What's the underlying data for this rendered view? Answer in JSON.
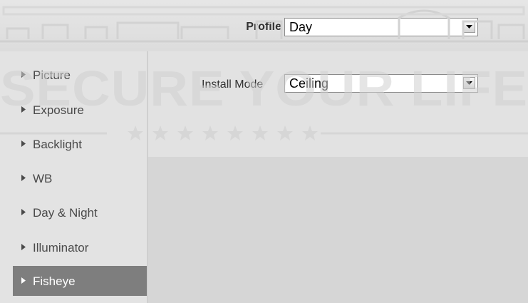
{
  "header": {
    "profile_label": "Profile",
    "profile_value": "Day"
  },
  "sidebar": {
    "items": [
      {
        "label": "Picture"
      },
      {
        "label": "Exposure"
      },
      {
        "label": "Backlight"
      },
      {
        "label": "WB"
      },
      {
        "label": "Day & Night"
      },
      {
        "label": "Illuminator"
      },
      {
        "label": "Fisheye"
      }
    ],
    "active_index": 6
  },
  "fisheye": {
    "install_mode_label": "Install Mode",
    "install_mode_value": "Ceiling"
  },
  "watermark": {
    "text": "SECURE YOUR LIFE"
  },
  "colors": {
    "active_item_bg": "#7e7e7e",
    "content_bg": "#d6d6d6",
    "sidebar_bg": "#e3e3e3"
  }
}
